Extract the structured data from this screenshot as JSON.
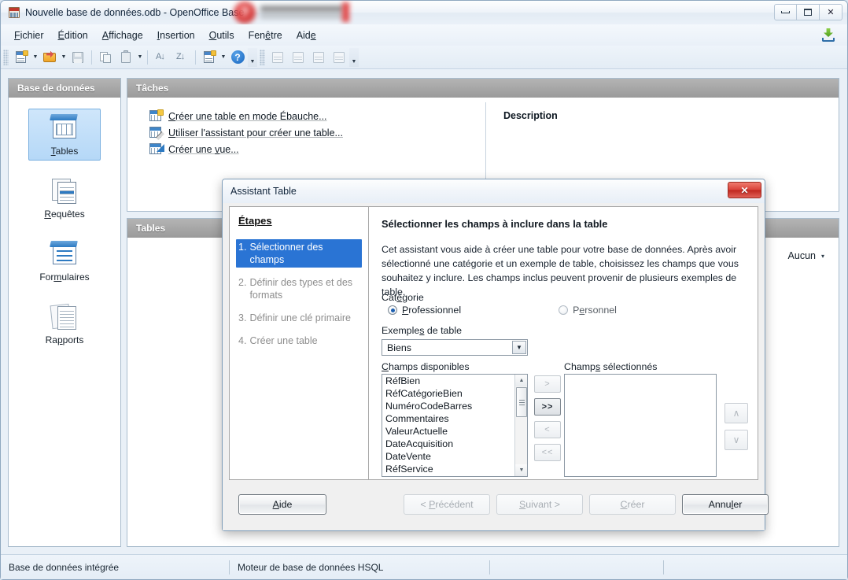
{
  "window": {
    "title": "Nouvelle base de données.odb - OpenOffice Base",
    "icon": "base-document-icon",
    "controls": {
      "minimize": "minimize-icon",
      "maximize": "maximize-icon",
      "close": "✕"
    }
  },
  "menubar": {
    "items": [
      {
        "label": "Fichier",
        "accel": "F"
      },
      {
        "label": "Édition",
        "accel": "É"
      },
      {
        "label": "Affichage",
        "accel": "A"
      },
      {
        "label": "Insertion",
        "accel": "I"
      },
      {
        "label": "Outils",
        "accel": "O"
      },
      {
        "label": "Fenêtre",
        "accel": "ê"
      },
      {
        "label": "Aide",
        "accel": "e"
      }
    ],
    "right_icon": "download-icon"
  },
  "toolbar": {
    "buttons": [
      "new-document-icon",
      "open-document-icon",
      "save-icon",
      "copy-icon",
      "paste-icon",
      "sort-ascending-icon",
      "sort-descending-icon",
      "form-wizard-icon",
      "help-icon",
      "print-preview-icon",
      "edit-icon",
      "edit-in-design-icon",
      "rename-icon"
    ]
  },
  "db_pane": {
    "header": "Base de données",
    "items": [
      {
        "label": "Tables",
        "accel": "T",
        "icon": "tables-icon",
        "selected": true
      },
      {
        "label": "Requêtes",
        "accel": "R",
        "icon": "queries-icon",
        "selected": false
      },
      {
        "label": "Formulaires",
        "accel": "u",
        "icon": "forms-icon",
        "selected": false
      },
      {
        "label": "Rapports",
        "accel": "p",
        "icon": "reports-icon",
        "selected": false
      }
    ]
  },
  "tasks_pane": {
    "header": "Tâches",
    "links": [
      {
        "label": "Créer une table en mode Ébauche...",
        "icon": "create-table-design-icon"
      },
      {
        "label": "Utiliser l'assistant pour créer une table...",
        "icon": "table-wizard-icon"
      },
      {
        "label": "Créer une vue...",
        "icon": "create-view-icon"
      }
    ],
    "description_title": "Description",
    "description_text": ""
  },
  "tables_pane": {
    "header": "Tables",
    "filter_label": "Aucun",
    "filter_caret": "▾"
  },
  "statusbar": {
    "cells": [
      "Base de données intégrée",
      "Moteur de base de données HSQL",
      "",
      ""
    ]
  },
  "dialog": {
    "title": "Assistant Table",
    "close_label": "✕",
    "steps_title": "Étapes",
    "steps": [
      {
        "num": "1.",
        "label": "Sélectionner des champs",
        "active": true
      },
      {
        "num": "2.",
        "label": "Définir des types et des formats",
        "active": false
      },
      {
        "num": "3.",
        "label": "Définir une clé primaire",
        "active": false
      },
      {
        "num": "4.",
        "label": "Créer une table",
        "active": false
      }
    ],
    "heading": "Sélectionner les champs à inclure dans la table",
    "intro": "Cet assistant vous aide à créer une table pour votre base de données. Après avoir sélectionné une catégorie et un exemple de table, choisissez les champs que vous souhaitez y inclure. Les champs inclus peuvent provenir de plusieurs exemples de table.",
    "category_label": "Catégorie",
    "category_options": [
      {
        "label": "Professionnel",
        "accel": "P",
        "checked": true
      },
      {
        "label": "Personnel",
        "accel": "e",
        "checked": false
      }
    ],
    "examples_label": "Exemples de table",
    "examples_accel": "s",
    "examples_value": "Biens",
    "examples_caret": "▼",
    "available_label": "Champs disponibles",
    "available_accel": "C",
    "available_fields": [
      "RéfBien",
      "RéfCatégorieBien",
      "NuméroCodeBarres",
      "Commentaires",
      "ValeurActuelle",
      "DateAcquisition",
      "DateVente",
      "RéfService"
    ],
    "selected_label": "Champs sélectionnés",
    "selected_accel": "s",
    "selected_fields": [],
    "transfer_buttons": [
      {
        "label": ">",
        "enabled": false
      },
      {
        "label": ">>",
        "enabled": true
      },
      {
        "label": "<",
        "enabled": false
      },
      {
        "label": "<<",
        "enabled": false
      }
    ],
    "order_buttons": [
      {
        "label": "∧",
        "enabled": false
      },
      {
        "label": "∨",
        "enabled": false
      }
    ],
    "buttons": {
      "help": {
        "label": "Aide",
        "accel": "A",
        "enabled": true
      },
      "back": {
        "label": "< Précédent",
        "accel": "P",
        "enabled": false
      },
      "next": {
        "label": "Suivant >",
        "accel": "S",
        "enabled": false
      },
      "create": {
        "label": "Créer",
        "accel": "C",
        "enabled": false
      },
      "cancel": {
        "label": "Annuler",
        "accel": "l",
        "enabled": true
      }
    }
  }
}
